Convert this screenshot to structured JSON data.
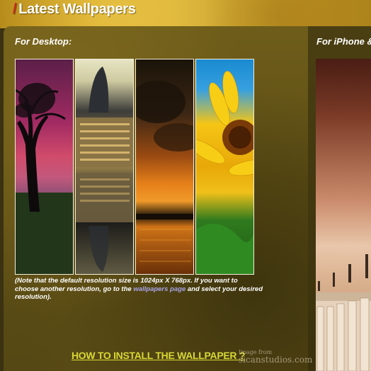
{
  "header": {
    "slash": "/",
    "title": "Latest Wallpapers"
  },
  "desktop": {
    "label": "For Desktop:",
    "thumbnails": [
      {
        "name": "tree-sunset"
      },
      {
        "name": "city-tower-reflection"
      },
      {
        "name": "orange-sky-sunset"
      },
      {
        "name": "sunflower"
      }
    ],
    "note_prefix": "(Note that the default resolution size is 1024px X 768px. If you want to choose another resolution, go to the ",
    "note_link": "wallpapers page",
    "note_suffix": " and select your desired resolution)."
  },
  "iphone": {
    "label": "For iPhone &"
  },
  "install_link": "HOW TO INSTALL THE WALLPAPER ?",
  "watermark": {
    "line1": "Image from",
    "line2": "sicanstudios.com"
  },
  "colors": {
    "title_slash": "#c8281e",
    "link_blue": "#a6a3e6",
    "install_yellow": "#d9d836"
  }
}
